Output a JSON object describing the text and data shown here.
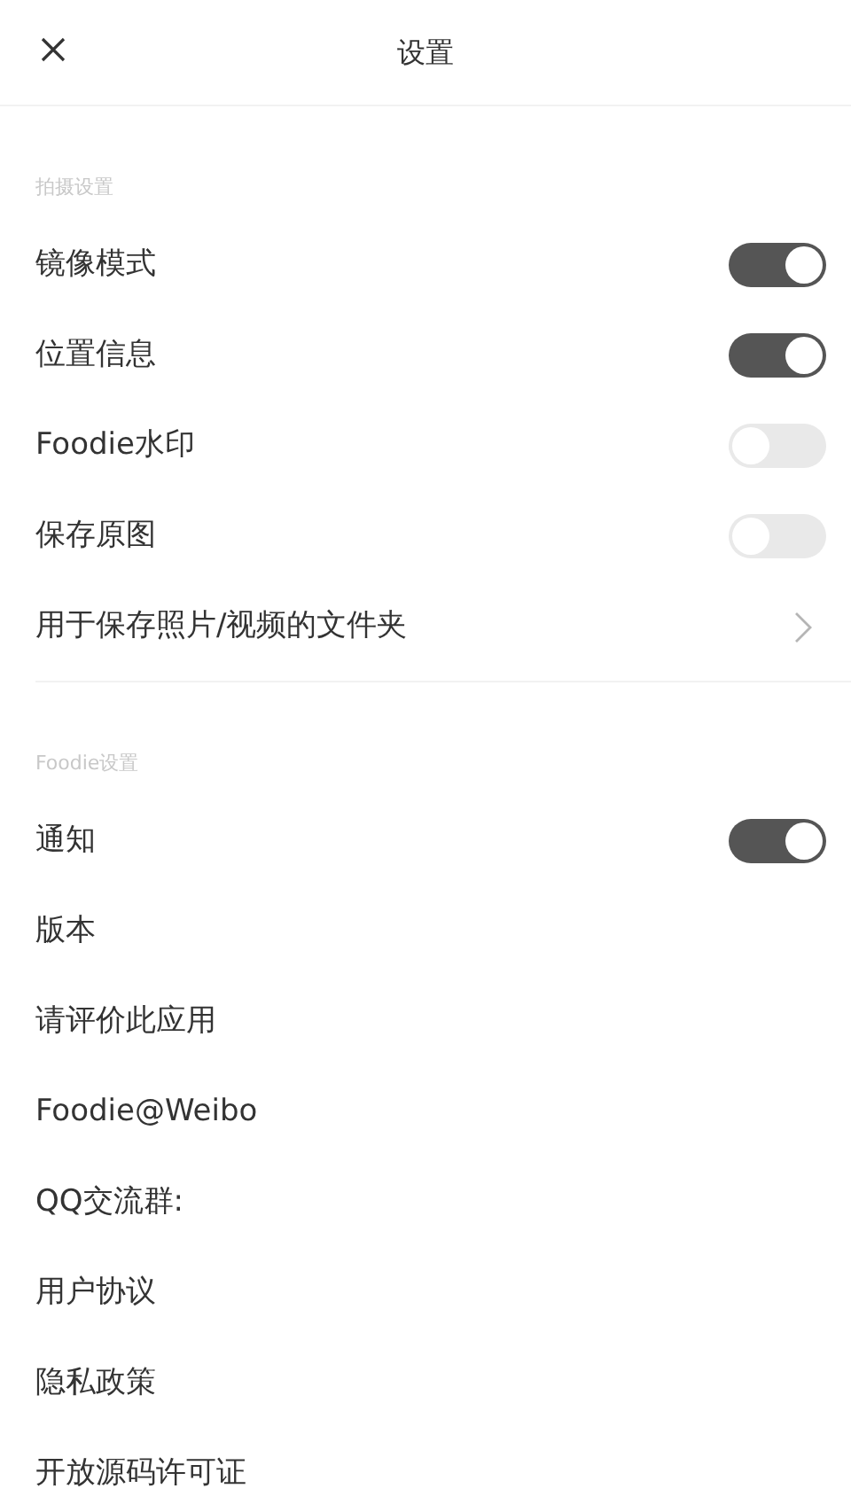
{
  "header": {
    "title": "设置"
  },
  "sections": [
    {
      "title": "拍摄设置",
      "items": [
        {
          "label": "镜像模式",
          "kind": "toggle",
          "on": true
        },
        {
          "label": "位置信息",
          "kind": "toggle",
          "on": true
        },
        {
          "label": "Foodie水印",
          "kind": "toggle",
          "on": false
        },
        {
          "label": "保存原图",
          "kind": "toggle",
          "on": false
        },
        {
          "label": "用于保存照片/视频的文件夹",
          "kind": "link"
        }
      ]
    },
    {
      "title": "Foodie设置",
      "items": [
        {
          "label": "通知",
          "kind": "toggle",
          "on": true
        },
        {
          "label": "版本",
          "kind": "plain"
        },
        {
          "label": "请评价此应用",
          "kind": "plain"
        },
        {
          "label": "Foodie@Weibo",
          "kind": "plain"
        },
        {
          "label": "QQ交流群:",
          "kind": "plain"
        },
        {
          "label": "用户协议",
          "kind": "plain"
        },
        {
          "label": "隐私政策",
          "kind": "plain"
        },
        {
          "label": "开放源码许可证",
          "kind": "plain"
        }
      ]
    }
  ]
}
